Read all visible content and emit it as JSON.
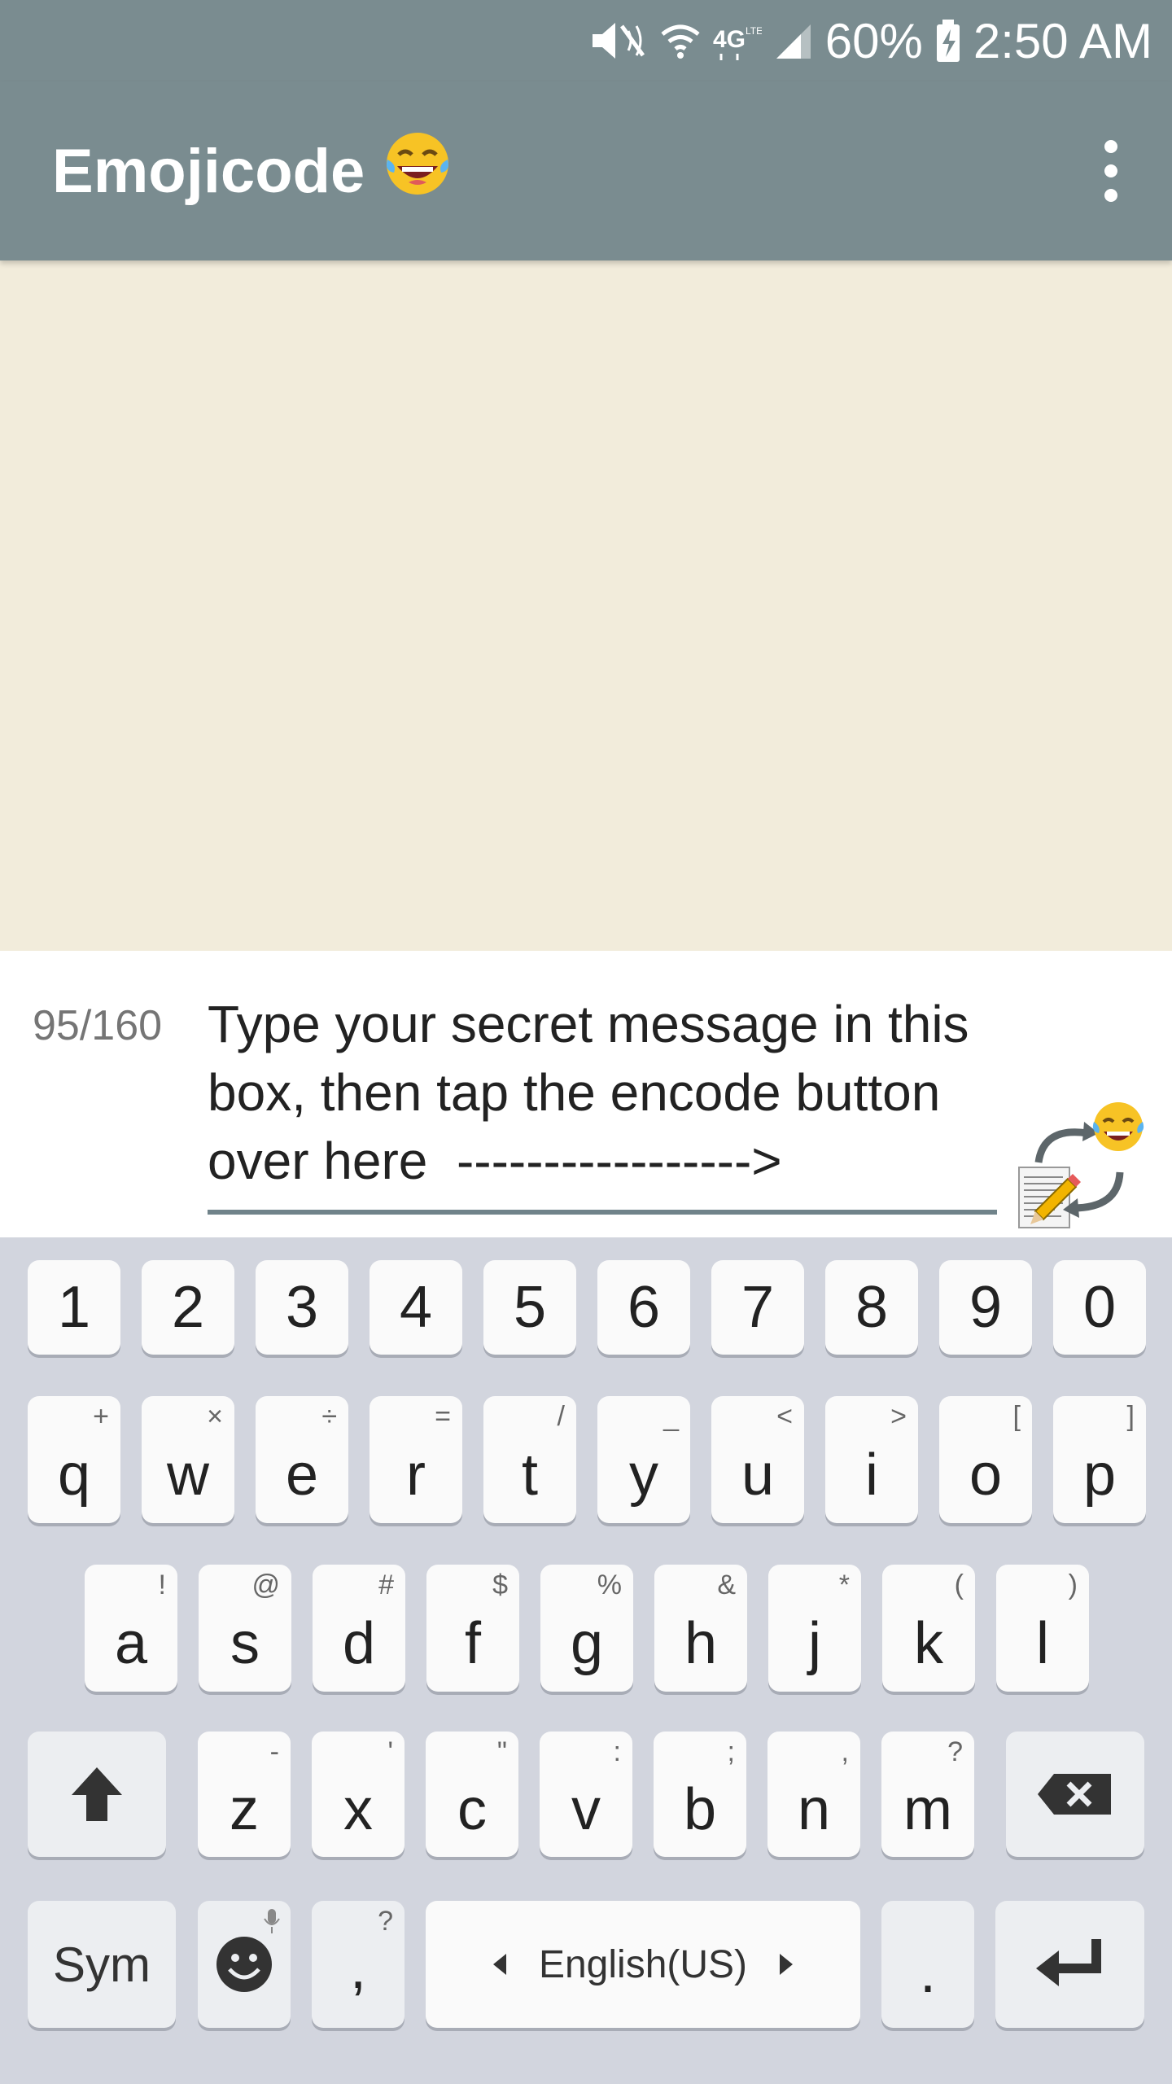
{
  "status_bar": {
    "battery": "60%",
    "time": "2:50 AM"
  },
  "app_bar": {
    "title": "Emojicode",
    "title_emoji": "😂"
  },
  "message": {
    "char_count": "95/160",
    "text": "Type your secret message in this box, then tap the encode button over here  ----------------->"
  },
  "keyboard": {
    "numbers": [
      "1",
      "2",
      "3",
      "4",
      "5",
      "6",
      "7",
      "8",
      "9",
      "0"
    ],
    "row1": [
      {
        "key": "q",
        "hint": "+"
      },
      {
        "key": "w",
        "hint": "×"
      },
      {
        "key": "e",
        "hint": "÷"
      },
      {
        "key": "r",
        "hint": "="
      },
      {
        "key": "t",
        "hint": "/"
      },
      {
        "key": "y",
        "hint": "_"
      },
      {
        "key": "u",
        "hint": "<"
      },
      {
        "key": "i",
        "hint": ">"
      },
      {
        "key": "o",
        "hint": "["
      },
      {
        "key": "p",
        "hint": "]"
      }
    ],
    "row2": [
      {
        "key": "a",
        "hint": "!"
      },
      {
        "key": "s",
        "hint": "@"
      },
      {
        "key": "d",
        "hint": "#"
      },
      {
        "key": "f",
        "hint": "$"
      },
      {
        "key": "g",
        "hint": "%"
      },
      {
        "key": "h",
        "hint": "&"
      },
      {
        "key": "j",
        "hint": "*"
      },
      {
        "key": "k",
        "hint": "("
      },
      {
        "key": "l",
        "hint": ")"
      }
    ],
    "row3": [
      {
        "key": "z",
        "hint": "-"
      },
      {
        "key": "x",
        "hint": "'"
      },
      {
        "key": "c",
        "hint": "\""
      },
      {
        "key": "v",
        "hint": ":"
      },
      {
        "key": "b",
        "hint": ";"
      },
      {
        "key": "n",
        "hint": ","
      },
      {
        "key": "m",
        "hint": "?"
      }
    ],
    "sym_label": "Sym",
    "comma": ",",
    "comma_hint": "?",
    "language": "English(US)",
    "period": "."
  }
}
